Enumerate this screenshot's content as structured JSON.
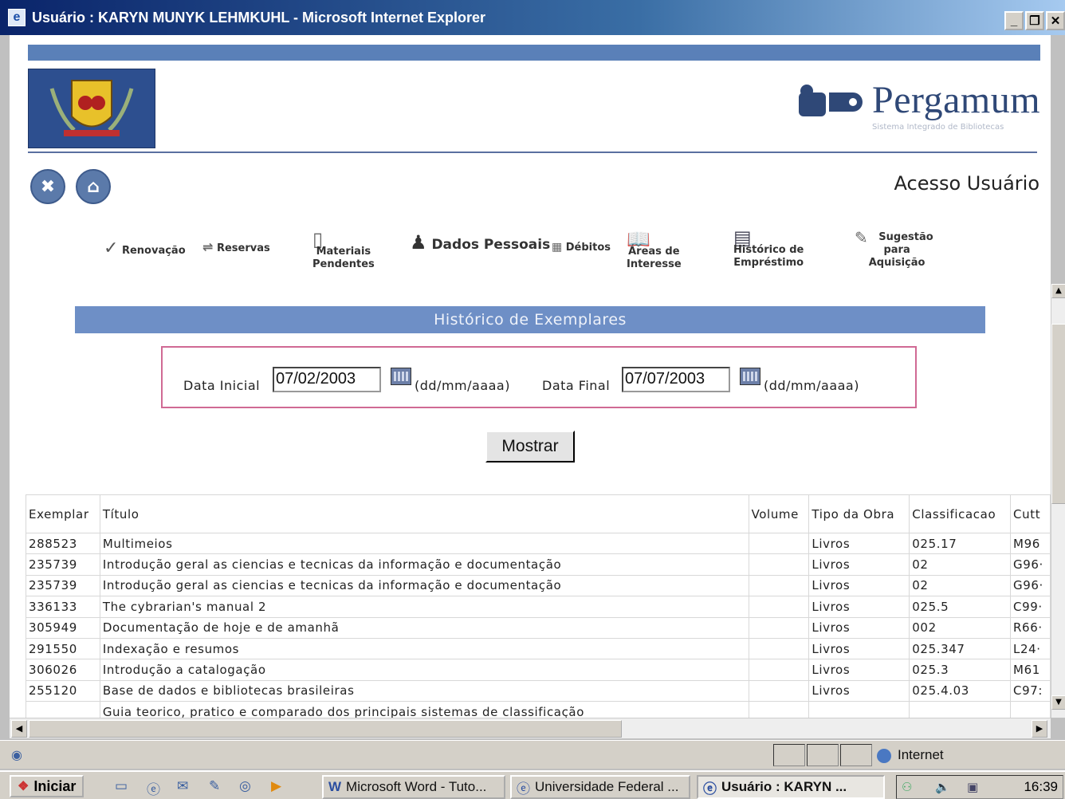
{
  "window": {
    "title": "Usuário : KARYN MUNYK LEHMKUHL - Microsoft Internet Explorer",
    "buttons": [
      "_",
      "❐",
      "✕"
    ]
  },
  "header": {
    "brand_name": "Pergamum",
    "brand_tagline": "Sistema Integrado de Bibliotecas",
    "page_title": "Acesso Usuário"
  },
  "menu": {
    "renovacao": "Renovação",
    "reservas": "Reservas",
    "materiais_line1": "Materiais",
    "materiais_line2": "Pendentes",
    "dados_pessoais": "Dados Pessoais",
    "debitos": "Débitos",
    "areas_line1": "Áreas de",
    "areas_line2": "Interesse",
    "historico_line1": "Histórico de",
    "historico_line2": "Empréstimo",
    "sugestao_line1": "Sugestão para",
    "sugestao_line2": "Aquisição"
  },
  "section_title": "Histórico de Exemplares",
  "filter": {
    "data_inicial_label": "Data Inicial",
    "data_inicial_value": "07/02/2003",
    "data_final_label": "Data Final",
    "data_final_value": "07/07/2003",
    "format_hint": "(dd/mm/aaaa)"
  },
  "mostrar_label": "Mostrar",
  "table": {
    "headers": [
      "Exemplar",
      "Título",
      "Volume",
      "Tipo da Obra",
      "Classificacao",
      "Cutt"
    ],
    "rows": [
      [
        "288523",
        "Multimeios",
        "",
        "Livros",
        "025.17",
        "M96"
      ],
      [
        "235739",
        "Introdução geral as ciencias e tecnicas da informação e documentação",
        "",
        "Livros",
        "02",
        "G96·"
      ],
      [
        "235739",
        "Introdução geral as ciencias e tecnicas da informação e documentação",
        "",
        "Livros",
        "02",
        "G96·"
      ],
      [
        "336133",
        "The cybrarian's manual 2",
        "",
        "Livros",
        "025.5",
        "C99·"
      ],
      [
        "305949",
        "Documentação de hoje e de amanhã",
        "",
        "Livros",
        "002",
        "R66·"
      ],
      [
        "291550",
        "Indexação e resumos",
        "",
        "Livros",
        "025.347",
        "L24·"
      ],
      [
        "306026",
        "Introdução a catalogação",
        "",
        "Livros",
        "025.3",
        "M61"
      ],
      [
        "255120",
        "Base de dados e bibliotecas brasileiras",
        "",
        "Livros",
        "025.4.03",
        "C97:"
      ],
      [
        "",
        "Guia teorico, pratico e comparado dos principais sistemas de classificação",
        "",
        "",
        "",
        ""
      ]
    ]
  },
  "statusbar": {
    "zone": "Internet"
  },
  "taskbar": {
    "start": "Iniciar",
    "tasks": [
      "Microsoft Word - Tuto...",
      "Universidade Federal ...",
      "Usuário : KARYN ..."
    ],
    "time": "16:39"
  },
  "colors": {
    "accent_blue": "#6e8fc6",
    "filter_border": "#d06a94",
    "brand_text": "#2f4877"
  }
}
